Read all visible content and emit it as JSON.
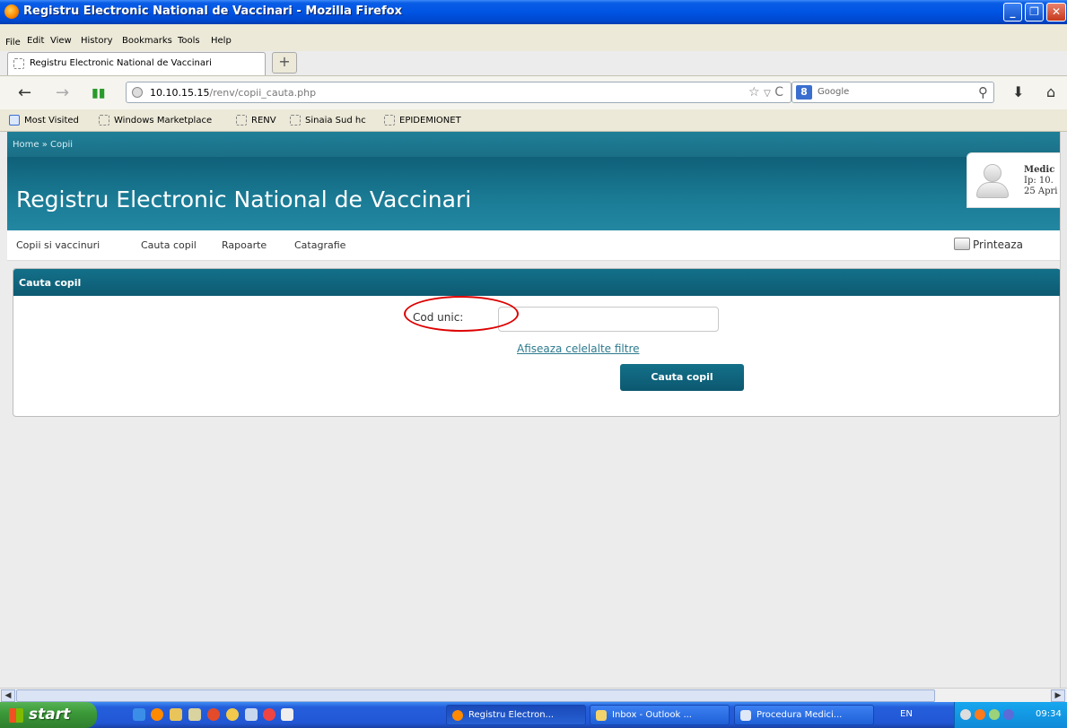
{
  "window": {
    "title": "Registru Electronic National de Vaccinari - Mozilla Firefox"
  },
  "menubar": {
    "items": [
      "File",
      "Edit",
      "View",
      "History",
      "Bookmarks",
      "Tools",
      "Help"
    ]
  },
  "tab": {
    "label": "Registru Electronic National de Vaccinari",
    "new_tab": "+"
  },
  "nav": {
    "url_host": "10.10.15.15",
    "url_path": "/renv/copii_cauta.php",
    "search_engine": "Google"
  },
  "bookmarks": [
    "Most Visited",
    "Windows Marketplace",
    "RENV",
    "Sinaia Sud hc",
    "EPIDEMIONET"
  ],
  "page": {
    "breadcrumb": "Home » Copii",
    "site_title": "Registru Electronic National de Vaccinari",
    "user": {
      "name": "Medic",
      "ip": "Ip: 10.",
      "date": "25 Apri"
    },
    "menu": [
      "Copii si vaccinuri",
      "Cauta copil",
      "Rapoarte",
      "Catagrafie"
    ],
    "print_label": "Printeaza",
    "panel_title": "Cauta copil",
    "field_label": "Cod unic:",
    "field_value": "",
    "filters_link": "Afiseaza celelalte filtre",
    "search_button": "Cauta copil"
  },
  "taskbar": {
    "start": "start",
    "tasks": [
      "Registru Electron...",
      "Inbox - Outlook ...",
      "Procedura Medici..."
    ],
    "lang": "EN",
    "clock": "09:34"
  }
}
